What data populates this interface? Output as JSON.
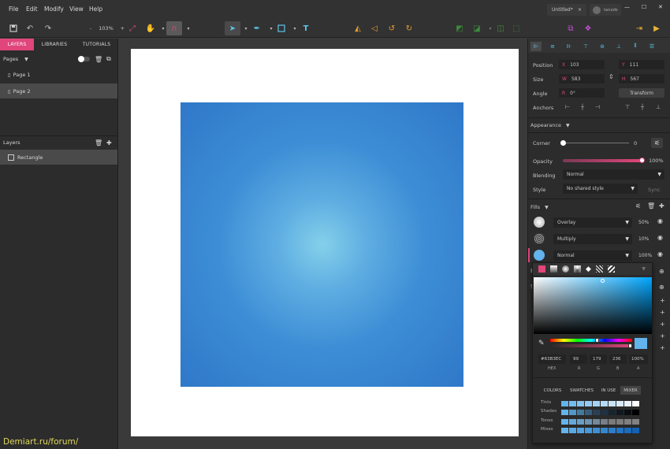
{
  "menu": [
    "File",
    "Edit",
    "Modify",
    "View",
    "Help"
  ],
  "doc_tab": {
    "title": "Untitled*",
    "close": "×"
  },
  "user": {
    "name": "lanzzb"
  },
  "window": {
    "minimize": "—",
    "maximize": "☐",
    "close": "✕"
  },
  "toolbar": {
    "zoom": "103%",
    "zoom_minus": "-",
    "zoom_plus": "+"
  },
  "left_tabs": [
    "LAYERS",
    "LIBRARIES",
    "TUTORIALS"
  ],
  "pages": {
    "header": "Pages",
    "items": [
      "Page 1",
      "Page 2"
    ],
    "selected": 1
  },
  "layers": {
    "header": "Layers",
    "items": [
      "Rectangle"
    ]
  },
  "position": {
    "label": "Position",
    "x_key": "X",
    "x": "103",
    "y_key": "Y",
    "y": "111"
  },
  "size": {
    "label": "Size",
    "w_key": "W",
    "w": "583",
    "h_key": "H",
    "h": "567"
  },
  "angle": {
    "label": "Angle",
    "key": "R",
    "value": "0°",
    "transform": "Transform"
  },
  "anchors": {
    "label": "Anchors"
  },
  "appearance": {
    "header": "Appearance"
  },
  "corner": {
    "label": "Corner",
    "value": "0",
    "level": 0
  },
  "opacity": {
    "label": "Opacity",
    "value": "100%",
    "level": 1.0
  },
  "blending": {
    "label": "Blending",
    "value": "Normal"
  },
  "style": {
    "label": "Style",
    "value": "No shared style",
    "sync": "Sync"
  },
  "fills": {
    "header": "Fills",
    "items": [
      {
        "mode": "Overlay",
        "opacity": "50%"
      },
      {
        "mode": "Multiply",
        "opacity": "10%"
      },
      {
        "mode": "Normal",
        "opacity": "100%"
      }
    ]
  },
  "picker": {
    "hex": "#63B3EC",
    "r": "99",
    "g": "179",
    "b": "236",
    "a": "100%",
    "labels": {
      "hex": "HEX",
      "r": "R",
      "g": "G",
      "b": "B",
      "a": "A"
    },
    "color": "#63b3ec"
  },
  "color_tabs": [
    "COLORS",
    "SWATCHES",
    "IN USE",
    "MIXER"
  ],
  "mixer": {
    "rows": [
      "Tints",
      "Shades",
      "Tones",
      "Mixes"
    ],
    "tints": [
      "#63b3ec",
      "#74bbee",
      "#84c3f0",
      "#95cbf2",
      "#a6d3f4",
      "#b7dbf6",
      "#c8e3f8",
      "#d9ebfa",
      "#eaf3fc",
      "#ffffff"
    ],
    "shades": [
      "#63b3ec",
      "#5196c6",
      "#44799f",
      "#375d7a",
      "#2a4155",
      "#1f3142",
      "#172430",
      "#11181f",
      "#0a0e12",
      "#000000"
    ],
    "tones": [
      "#63b3ec",
      "#67a8d8",
      "#6b9ec4",
      "#6f93b0",
      "#73899c",
      "#777f88",
      "#7b7b7b",
      "#7d7d7d",
      "#808080",
      "#828282"
    ],
    "mixes": [
      "#63b3ec",
      "#5aaae6",
      "#51a1e0",
      "#4898da",
      "#3f8fd4",
      "#3686ce",
      "#2d7dc8",
      "#2474c2",
      "#1b6bbc",
      "#1262b6"
    ]
  },
  "watermark": "Demiart.ru/forum/"
}
